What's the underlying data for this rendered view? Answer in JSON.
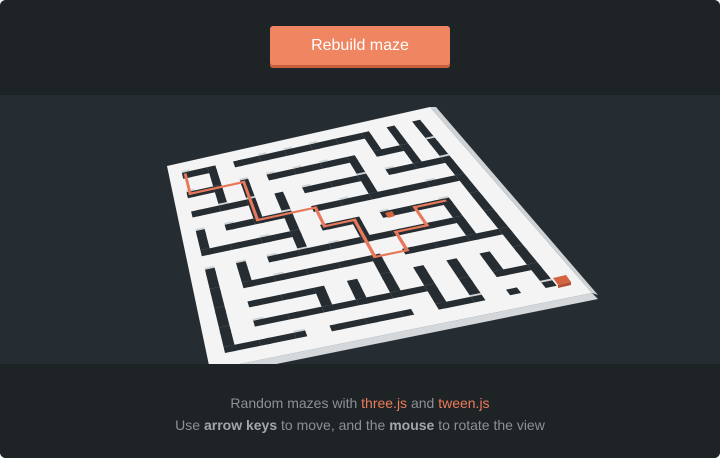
{
  "header": {
    "rebuild_label": "Rebuild maze"
  },
  "maze": {
    "wall_top_color": "#f4f4f4",
    "wall_side_color": "#cfd3d5",
    "floor_color": "#262d32",
    "path_color": "#e8785a",
    "player_color": "#d4643f"
  },
  "footer": {
    "line1": {
      "prefix": "Random mazes with",
      "link1": "three.js",
      "joiner": "and",
      "link2": "tween.js"
    },
    "line2": {
      "prefix": "Use",
      "keys": "arrow keys",
      "middle": "to move, and the",
      "mouse": "mouse",
      "suffix": "to rotate the view"
    }
  }
}
